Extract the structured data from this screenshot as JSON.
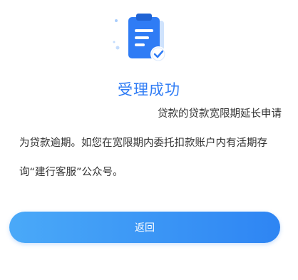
{
  "page": {
    "title": "受理成功",
    "message_lines": [
      "贷款的贷款宽限期延长申请",
      "为贷款逾期。如您在宽限期内委托扣款账户内有活期存",
      "询“建行客服”公众号。"
    ]
  },
  "actions": {
    "back_label": "返回"
  },
  "theme": {
    "accent": "#2f7cf5",
    "button_gradient_start": "#4aa9f8",
    "button_gradient_end": "#2e85f3"
  }
}
